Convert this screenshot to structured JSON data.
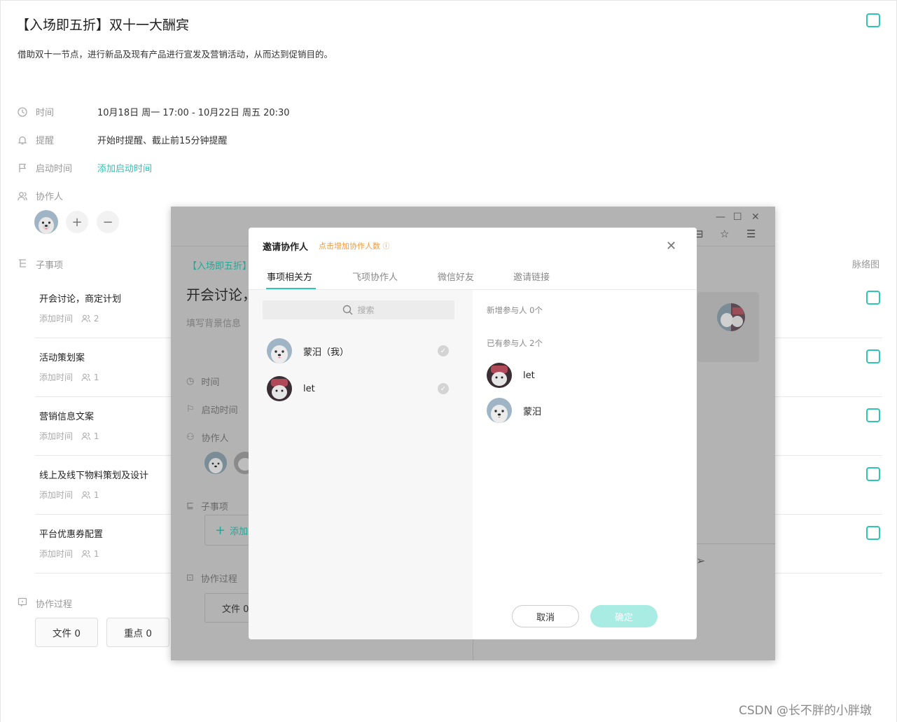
{
  "task": {
    "title": "【入场即五折】双十一大酬宾",
    "description": "借助双十一节点，进行新品及现有产品进行宣发及营销活动，从而达到促销目的。",
    "fields": {
      "time_label": "时间",
      "time_value": "10月18日 周一 17:00 - 10月22日 周五 20:30",
      "reminder_label": "提醒",
      "reminder_value": "开始时提醒、截止前15分钟提醒",
      "start_label": "启动时间",
      "start_value": "添加启动时间",
      "collaborators_label": "协作人"
    },
    "subtasks_label": "子事项",
    "mindmap_label": "脉络图",
    "subtasks": [
      {
        "name": "开会讨论，商定计划",
        "time": "添加时间",
        "count": "2"
      },
      {
        "name": "活动策划案",
        "time": "添加时间",
        "count": "1"
      },
      {
        "name": "营销信息文案",
        "time": "添加时间",
        "count": "1"
      },
      {
        "name": "线上及线下物料策划及设计",
        "time": "添加时间",
        "count": "1"
      },
      {
        "name": "平台优惠券配置",
        "time": "添加时间",
        "count": "1"
      }
    ],
    "process_label": "协作过程",
    "file_btn": "文件 0",
    "key_btn": "重点 0"
  },
  "bg_window": {
    "tag": "【入场即五折】",
    "heading": "开会讨论，",
    "bg_placeholder": "填写背景信息",
    "time_label": "时间",
    "start_label": "启动时间",
    "collab_label": "协作人",
    "sub_label": "子事项",
    "add_label": "添加",
    "process_label": "协作过程",
    "file_label": "文件 0"
  },
  "modal": {
    "title": "邀请协作人",
    "hint": "点击增加协作人数",
    "tabs": [
      "事项相关方",
      "飞项协作人",
      "微信好友",
      "邀请链接"
    ],
    "search_placeholder": "搜索",
    "people": [
      {
        "name": "蒙汨（我）",
        "avatar": "dog"
      },
      {
        "name": "let",
        "avatar": "hat"
      }
    ],
    "new_count": "新增参与人 0个",
    "existing_count": "已有参与人 2个",
    "existing": [
      {
        "name": "let",
        "avatar": "hat"
      },
      {
        "name": "蒙汨",
        "avatar": "dog"
      }
    ],
    "cancel": "取消",
    "confirm": "确定"
  },
  "watermark": "CSDN @长不胖的小胖墩",
  "colors": {
    "accent": "#2ec4b6",
    "hint": "#f59a3c",
    "confirm_disabled": "#a8ece4"
  }
}
